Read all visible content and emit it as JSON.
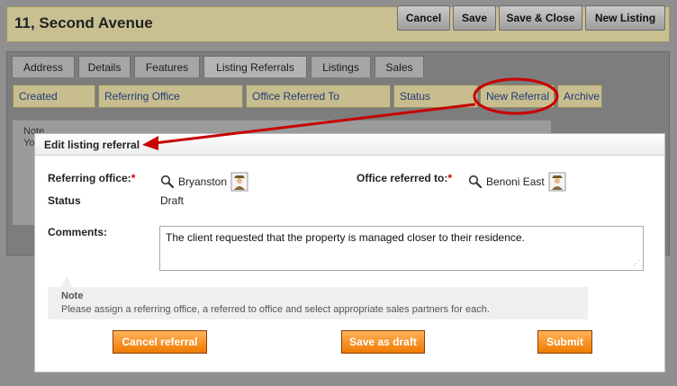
{
  "header": {
    "title": "11, Second Avenue",
    "buttons": {
      "cancel": "Cancel",
      "save": "Save",
      "save_close": "Save & Close",
      "new_listing": "New Listing"
    }
  },
  "tabs": [
    "Address",
    "Details",
    "Features",
    "Listing Referrals",
    "Listings",
    "Sales"
  ],
  "active_tab": "Listing Referrals",
  "referral_toolbar": {
    "columns": [
      "Created",
      "Referring Office",
      "Office Referred To",
      "Status"
    ],
    "new_referral": "New Referral",
    "archive": "Archive"
  },
  "background_note": {
    "title": "Note",
    "text": "Yo"
  },
  "dialog": {
    "title": "Edit listing referral",
    "referring_office_label": "Referring office:",
    "referring_office_value": "Bryanston",
    "office_referred_to_label": "Office referred to:",
    "office_referred_to_value": "Benoni East",
    "required_mark": "*",
    "status_label": "Status",
    "status_value": "Draft",
    "comments_label": "Comments:",
    "comments_value": "The client requested that the property is managed closer to their residence.",
    "note_title": "Note",
    "note_text": "Please assign a referring office, a referred to office and select appropriate sales partners for each.",
    "buttons": {
      "cancel_referral": "Cancel referral",
      "save_draft": "Save as draft",
      "submit": "Submit"
    }
  },
  "colors": {
    "header_bg": "#c9c092",
    "subtab_bg": "#c7bd8e",
    "annotation_red": "#c80000",
    "button_orange": "#f07a00"
  },
  "icons": {
    "lookup": "search-icon",
    "person": "person-icon"
  }
}
